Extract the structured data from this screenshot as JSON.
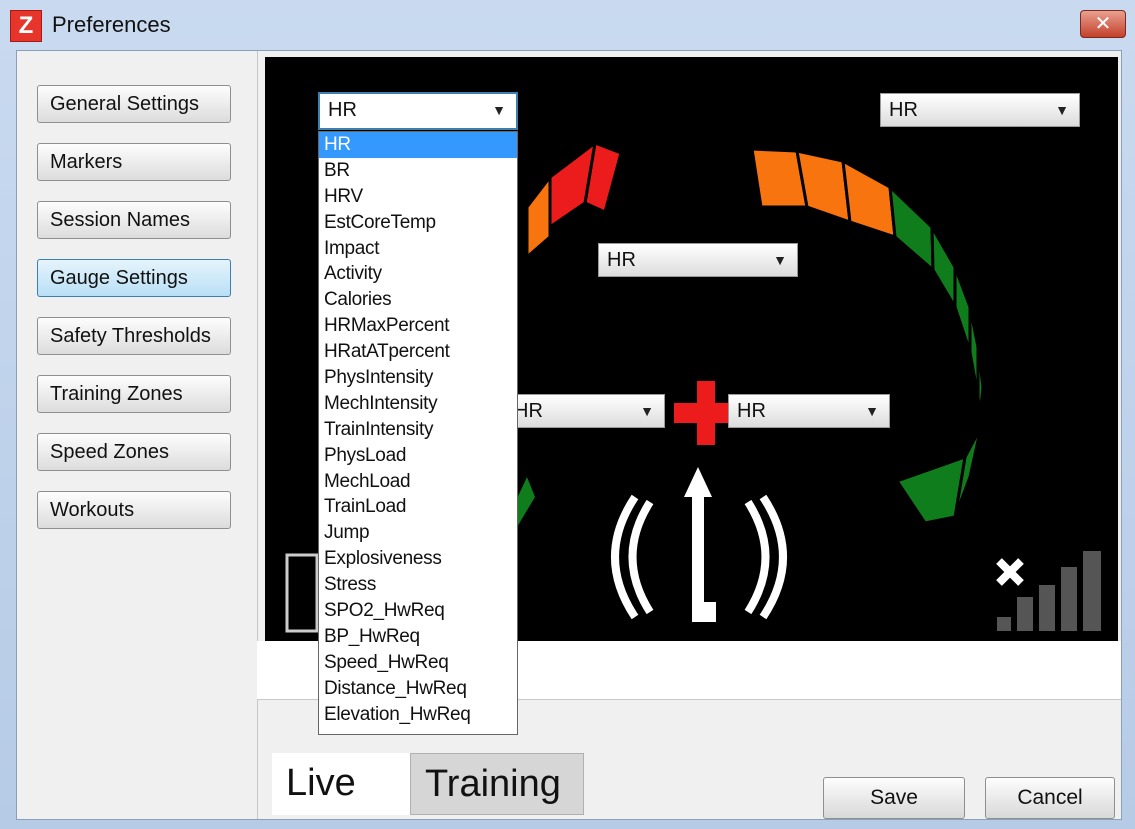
{
  "window": {
    "title": "Preferences",
    "app_icon": "Z",
    "close_glyph": "✕"
  },
  "sidebar": {
    "items": [
      {
        "label": "General Settings"
      },
      {
        "label": "Markers"
      },
      {
        "label": "Session Names"
      },
      {
        "label": "Gauge Settings",
        "active": true
      },
      {
        "label": "Safety Thresholds"
      },
      {
        "label": "Training Zones"
      },
      {
        "label": "Speed Zones"
      },
      {
        "label": "Workouts"
      }
    ]
  },
  "gauge": {
    "combo_top_left": "HR",
    "combo_top_right": "HR",
    "combo_center": "HR",
    "combo_mid_left": "HR",
    "combo_mid_right": "HR",
    "colors": {
      "red": "#ec1c1c",
      "orange": "#f7740e",
      "green": "#0f7d1c"
    }
  },
  "dropdown": {
    "selected": "HR",
    "options": [
      "HR",
      "BR",
      "HRV",
      "EstCoreTemp",
      "Impact",
      "Activity",
      "Calories",
      "HRMaxPercent",
      "HRatATpercent",
      "PhysIntensity",
      "MechIntensity",
      "TrainIntensity",
      "PhysLoad",
      "MechLoad",
      "TrainLoad",
      "Jump",
      "Explosiveness",
      "Stress",
      "SPO2_HwReq",
      "BP_HwReq",
      "Speed_HwReq",
      "Distance_HwReq",
      "Elevation_HwReq"
    ]
  },
  "tabs": {
    "live": "Live",
    "training": "Training"
  },
  "buttons": {
    "save": "Save",
    "cancel": "Cancel"
  },
  "icons": [
    "app-icon",
    "close-icon",
    "chevron-down-icon",
    "medical-cross-icon",
    "vibration-arrow-icon",
    "x-icon",
    "signal-bars-icon"
  ]
}
